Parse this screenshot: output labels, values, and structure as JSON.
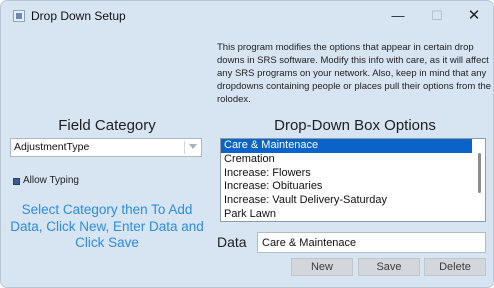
{
  "window": {
    "title": "Drop Down Setup",
    "controls": {
      "minimize": "—",
      "maximize": "☐",
      "close": "✕"
    }
  },
  "info_text": "This program modifies the options that appear in certain drop downs in SRS software.  Modify this info with care, as it will affect any SRS programs on your network.  Also, keep in mind that any dropdowns containing people or places pull their options from the rolodex.",
  "field_category": {
    "title": "Field Category",
    "selected": "AdjustmentType"
  },
  "allow_typing": {
    "label": "Allow Typing",
    "checked": true
  },
  "instructions": "Select Category then To Add Data, Click New, Enter Data and Click Save",
  "dropdown_options": {
    "title": "Drop-Down Box Options",
    "items": [
      "Care & Maintenace",
      "Cremation",
      "Increase: Flowers",
      "Increase: Obituaries",
      "Increase: Vault Delivery-Saturday",
      "Park Lawn"
    ],
    "selected_index": 0
  },
  "data_field": {
    "label": "Data",
    "value": "Care & Maintenace"
  },
  "buttons": {
    "new": "New",
    "save": "Save",
    "delete": "Delete"
  },
  "colors": {
    "accent": "#0a63c9",
    "instruction_text": "#2e8be6",
    "window_bg": "#d7e4f2"
  }
}
